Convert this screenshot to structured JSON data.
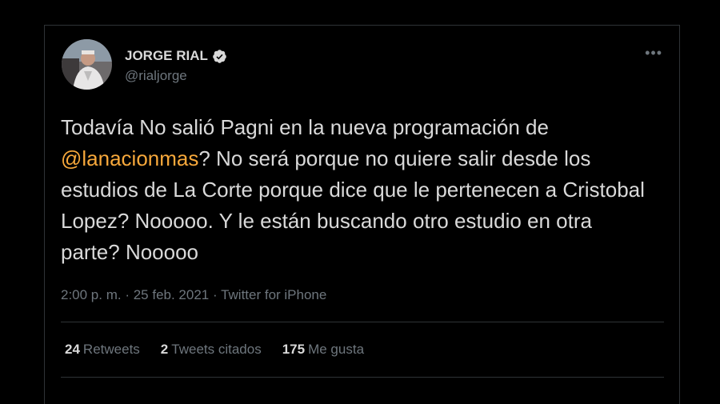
{
  "author": {
    "name": "JORGE RIAL",
    "handle": "@rialjorge",
    "verified_icon": "verified-badge-icon"
  },
  "menu": {
    "more_label": "•••"
  },
  "tweet": {
    "text_before": "Todavía No salió Pagni en la nueva programación de",
    "mention": "@lanacionmas",
    "text_after": "? No será porque no quiere salir desde los estudios de La Corte porque dice que le pertenecen a Cristobal Lopez? Nooooo. Y le están buscando otro estudio en otra parte? Nooooo"
  },
  "meta": {
    "time": "2:00 p. m.",
    "date": "25 feb. 2021",
    "source": "Twitter for iPhone",
    "separator": " · "
  },
  "stats": {
    "retweets_count": "24",
    "retweets_label": "Retweets",
    "quotes_count": "2",
    "quotes_label": "Tweets citados",
    "likes_count": "175",
    "likes_label": "Me gusta"
  },
  "colors": {
    "background": "#000000",
    "text": "#d9d9d9",
    "muted": "#6e767d",
    "mention": "#f7a83b",
    "divider": "#2f3336"
  }
}
